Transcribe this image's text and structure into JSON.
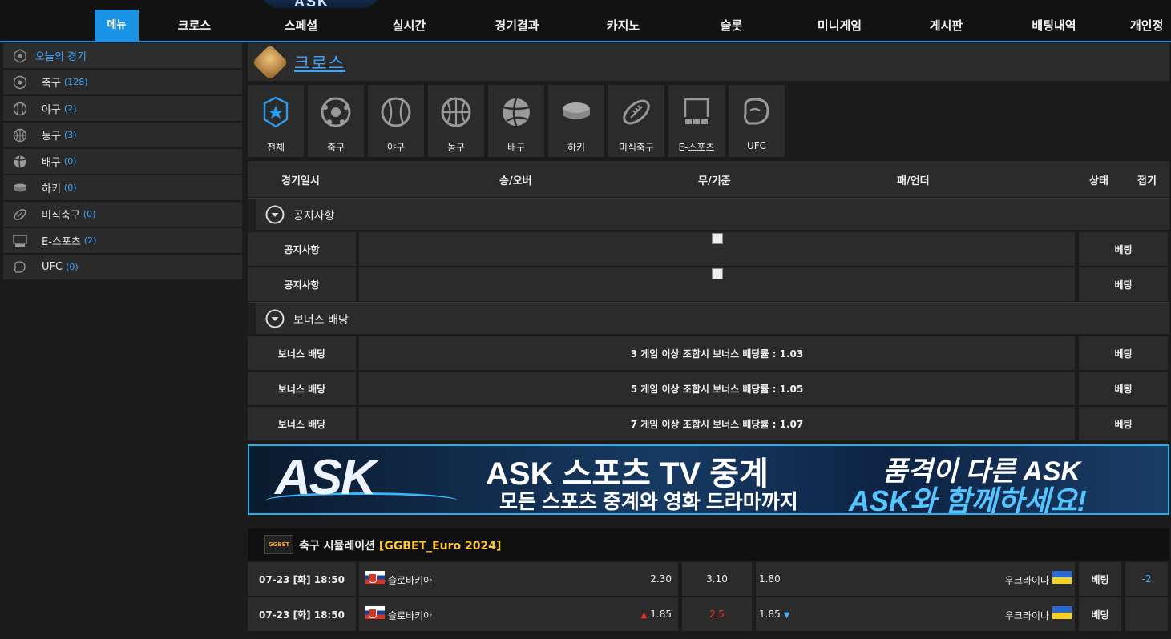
{
  "brand": {
    "logo_text": "ASK"
  },
  "nav": {
    "items": [
      "메뉴",
      "크로스",
      "스페셜",
      "실시간",
      "경기결과",
      "카지노",
      "슬롯",
      "미니게임",
      "게시판",
      "배팅내역",
      "개인정"
    ]
  },
  "sidebar": {
    "title": "오늘의 경기",
    "items": [
      {
        "label": "축구",
        "count": "(128)",
        "icon": "soccer-icon"
      },
      {
        "label": "야구",
        "count": "(2)",
        "icon": "baseball-icon"
      },
      {
        "label": "농구",
        "count": "(3)",
        "icon": "basketball-icon"
      },
      {
        "label": "배구",
        "count": "(0)",
        "icon": "volleyball-icon"
      },
      {
        "label": "하키",
        "count": "(0)",
        "icon": "hockey-icon"
      },
      {
        "label": "미식축구",
        "count": "(0)",
        "icon": "football-icon"
      },
      {
        "label": "E-스포츠",
        "count": "(2)",
        "icon": "esports-icon"
      },
      {
        "label": "UFC",
        "count": "(0)",
        "icon": "ufc-icon"
      }
    ]
  },
  "main": {
    "title": "크로스",
    "categories": [
      "전체",
      "축구",
      "야구",
      "농구",
      "배구",
      "하키",
      "미식축구",
      "E-스포츠",
      "UFC"
    ],
    "table_head": {
      "date": "경기일시",
      "win": "승/오버",
      "draw": "무/기준",
      "lose": "패/언더",
      "status": "상태",
      "fold": "접기"
    },
    "notice_section": {
      "title": "공지사항",
      "rows": [
        {
          "label": "공지사항",
          "action": "베팅"
        },
        {
          "label": "공지사항",
          "action": "베팅"
        }
      ]
    },
    "bonus_section": {
      "title": "보너스 배당",
      "rows": [
        {
          "label": "보너스 배당",
          "text": "3 게임 이상 조합시 보너스 배당률 : 1.03",
          "action": "베팅"
        },
        {
          "label": "보너스 배당",
          "text": "5 게임 이상 조합시 보너스 배당률 : 1.05",
          "action": "베팅"
        },
        {
          "label": "보너스 배당",
          "text": "7 게임 이상 조합시 보너스 배당률 : 1.07",
          "action": "베팅"
        }
      ]
    },
    "banner": {
      "logo": "ASK",
      "line1": "ASK 스포츠 TV 중계",
      "line2": "모든 스포츠 중계와 영화 드라마까지",
      "line3": "품격이 다른 ASK",
      "line4": "ASK와 함께하세요!"
    },
    "simulation": {
      "badge": "GGBET",
      "title": "축구 시뮬레이션",
      "league": "[GGBET_Euro 2024]",
      "matches": [
        {
          "date": "07-23 [화] 18:50",
          "home": "슬로바키아",
          "home_odds": "2.30",
          "mid": "3.10",
          "away_odds": "1.80",
          "away": "우크라이나",
          "action": "베팅",
          "extra": "-2"
        },
        {
          "date": "07-23 [화] 18:50",
          "home": "슬로바키아",
          "home_odds": "1.85",
          "mid": "2.5",
          "away_odds": "1.85",
          "away": "우크라이나",
          "action": "베팅",
          "extra": ""
        }
      ]
    }
  },
  "colors": {
    "accent": "#1b93e5",
    "link": "#3ea5ff",
    "gold": "#ffc83d",
    "up": "#ee3333",
    "down": "#4cb0ff"
  }
}
